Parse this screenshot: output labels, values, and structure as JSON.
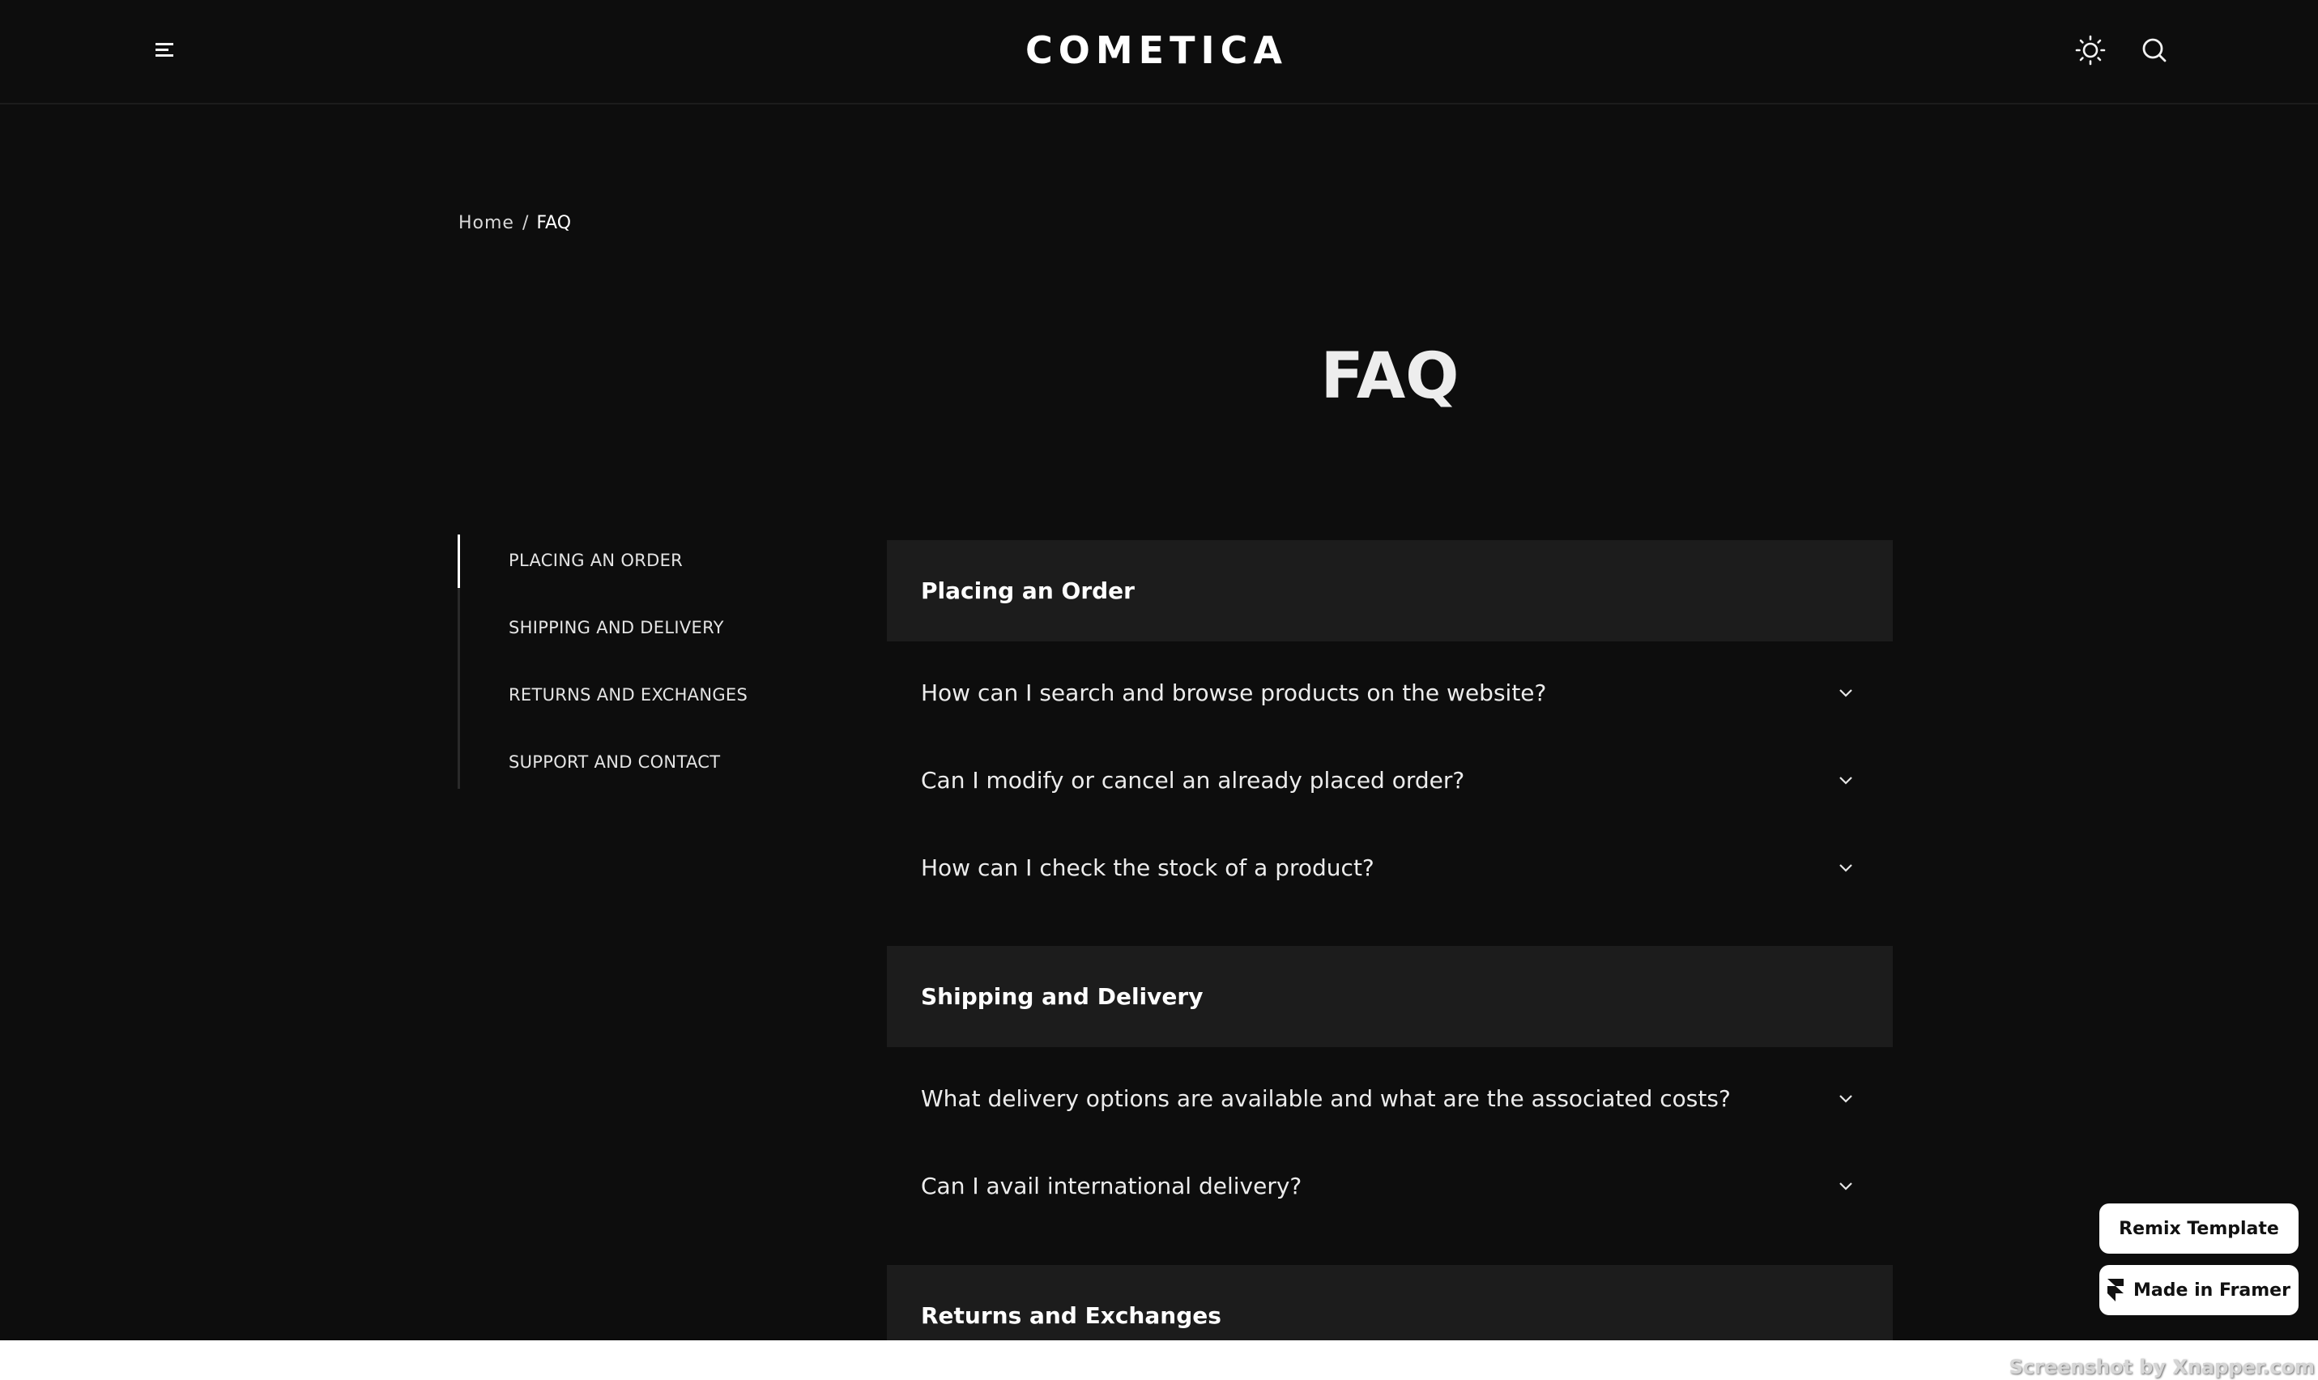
{
  "header": {
    "logo": "COMETICA",
    "menu_icon": "hamburger-menu-icon",
    "theme_icon": "sun-icon",
    "search_icon": "search-icon"
  },
  "breadcrumb": {
    "home": "Home",
    "separator": "/",
    "current": "FAQ"
  },
  "page_title": "FAQ",
  "sidenav": {
    "items": [
      {
        "label": "PLACING AN ORDER",
        "active": true
      },
      {
        "label": "SHIPPING AND DELIVERY",
        "active": false
      },
      {
        "label": "RETURNS AND EXCHANGES",
        "active": false
      },
      {
        "label": "SUPPORT AND CONTACT",
        "active": false
      }
    ]
  },
  "sections": [
    {
      "title": "Placing an Order",
      "questions": [
        "How can I search and browse products on the website?",
        "Can I modify or cancel an already placed order?",
        "How can I check the stock of a product?"
      ]
    },
    {
      "title": "Shipping and Delivery",
      "questions": [
        "What delivery options are available and what are the associated costs?",
        "Can I avail international delivery?"
      ]
    },
    {
      "title": "Returns and Exchanges",
      "questions": []
    }
  ],
  "badges": {
    "remix": "Remix Template",
    "framer": "Made in Framer",
    "framer_icon": "framer-logo-icon"
  },
  "watermark": "Screenshot by Xnapper.com",
  "colors": {
    "background": "#0d0d0d",
    "section_header_bg": "#1c1c1c",
    "text": "#e6e6e6",
    "badge_bg": "#ffffff"
  }
}
